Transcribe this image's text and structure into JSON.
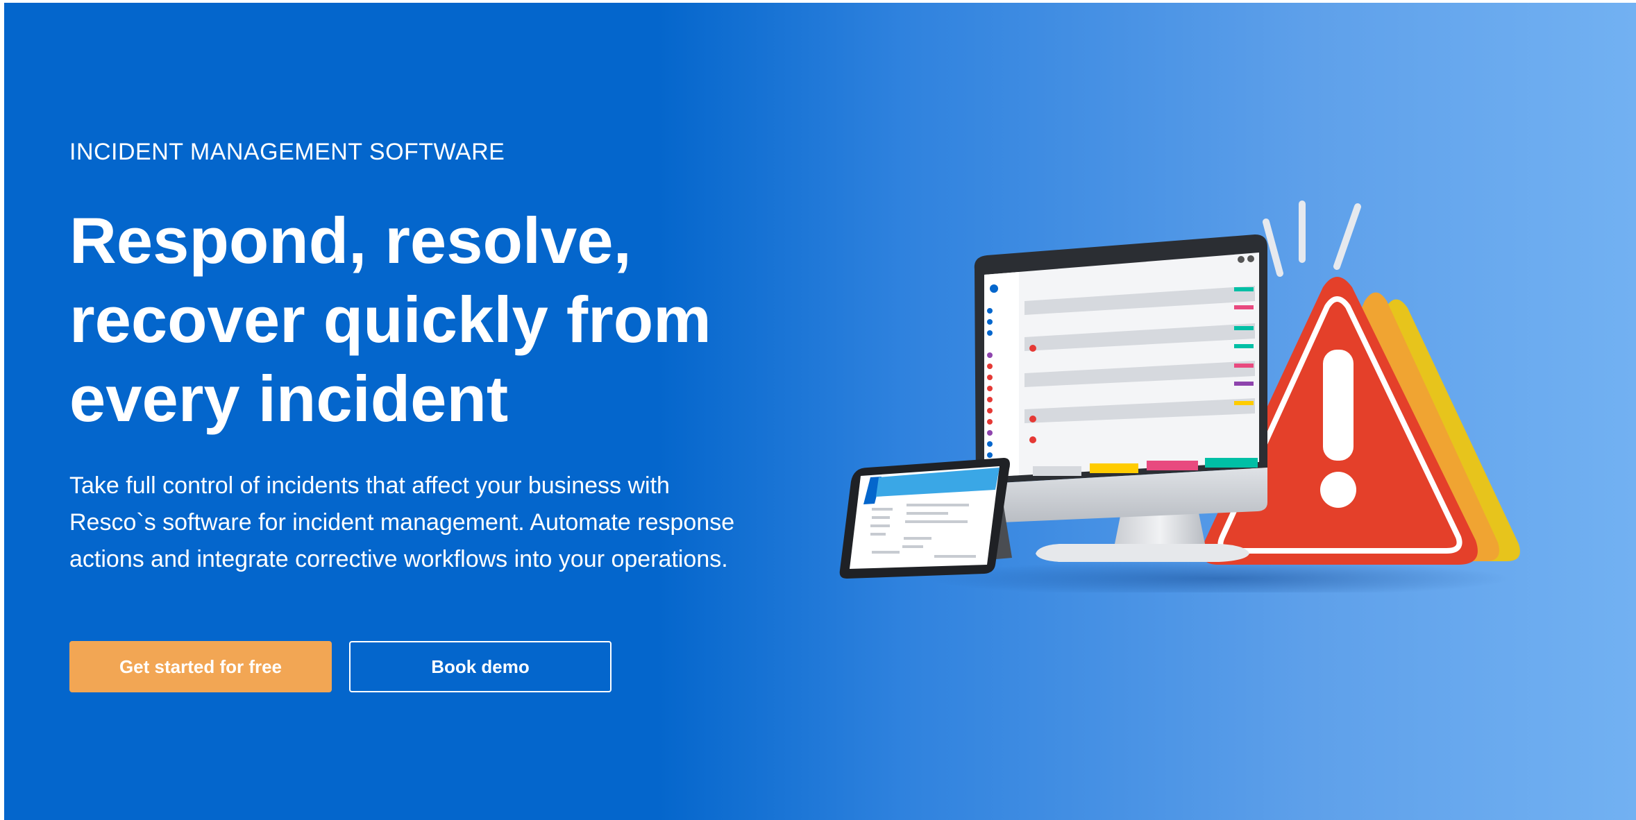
{
  "hero": {
    "eyebrow": "INCIDENT MANAGEMENT SOFTWARE",
    "headline_lines": [
      "Respond, resolve,",
      "recover quickly from",
      "every incident"
    ],
    "description": "Take full control of incidents that affect your business with Resco`s software for incident management. Automate response actions and integrate corrective workflows into your operations.",
    "primary_button": "Get started for free",
    "secondary_button": "Book demo"
  },
  "illustration": {
    "alert_icon": "warning-triangle-icon",
    "status_colors": [
      "#00bfa5",
      "#e84a7f",
      "#ffcc00",
      "#8e44ad",
      "#0466cc",
      "#e53935"
    ]
  },
  "colors": {
    "background": "#0466cc",
    "primary_button": "#f2a654",
    "alert": "#e4402a"
  }
}
